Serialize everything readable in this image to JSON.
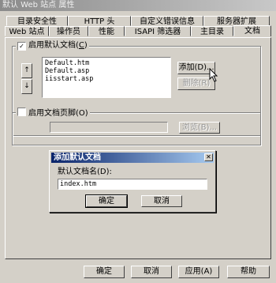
{
  "window": {
    "title": "默认 Web 站点 属性"
  },
  "tabs_back": [
    "目录安全性",
    "HTTP 头",
    "自定义错误信息",
    "服务器扩展"
  ],
  "tabs_front": [
    "Web 站点",
    "操作员",
    "性能",
    "ISAPI 筛选器",
    "主目录",
    "文档"
  ],
  "active_tab": "文档",
  "default_doc": {
    "checkbox_label": "启用默认文档",
    "checkbox_underline": "C",
    "checked": true,
    "items": [
      "Default.htm",
      "Default.asp",
      "iisstart.asp"
    ],
    "add_label": "添加(D)...",
    "remove_label": "删除(R)",
    "up_icon": "arrow-up-icon",
    "down_icon": "arrow-down-icon"
  },
  "footer_doc": {
    "checkbox_label": "启用文档页脚(O)",
    "checked": false,
    "value": "",
    "browse_label": "浏览(B)..."
  },
  "dialog": {
    "title": "添加默认文档",
    "field_label": "默认文档名(D):",
    "value": "index.htm",
    "ok_label": "确定",
    "cancel_label": "取消"
  },
  "bottom_buttons": {
    "ok": "确定",
    "cancel": "取消",
    "apply": "应用(A)",
    "help": "帮助"
  }
}
